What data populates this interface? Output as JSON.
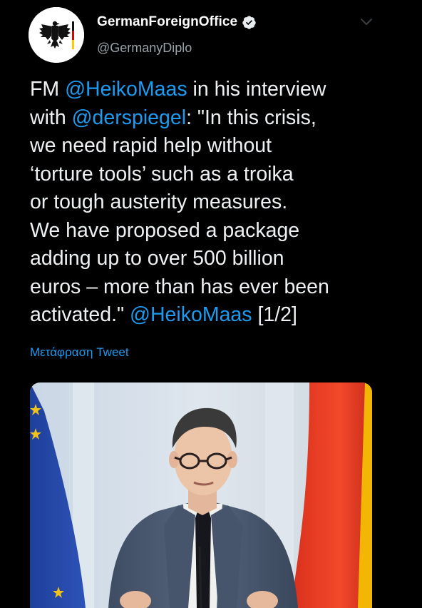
{
  "account": {
    "display_name": "GermanForeignOffice",
    "handle": "@GermanyDiplo",
    "verified": true
  },
  "tweet": {
    "lines": [
      [
        {
          "t": "FM ",
          "m": false
        },
        {
          "t": "@HeikoMaas",
          "m": true
        },
        {
          "t": " in his interview",
          "m": false
        }
      ],
      [
        {
          "t": "with ",
          "m": false
        },
        {
          "t": "@derspiegel",
          "m": true
        },
        {
          "t": ": \"In this crisis,",
          "m": false
        }
      ],
      [
        {
          "t": "we need rapid help without",
          "m": false
        }
      ],
      [
        {
          "t": "‘torture tools’ such as a troika",
          "m": false
        }
      ],
      [
        {
          "t": "or tough austerity measures.",
          "m": false
        }
      ],
      [
        {
          "t": "We have proposed a package",
          "m": false
        }
      ],
      [
        {
          "t": "adding up to over 500 billion",
          "m": false
        }
      ],
      [
        {
          "t": "euros – more than has ever been",
          "m": false
        }
      ],
      [
        {
          "t": "activated.\" ",
          "m": false
        },
        {
          "t": "@HeikoMaas",
          "m": true
        },
        {
          "t": " [1/2]",
          "m": false
        }
      ]
    ],
    "translate_label": "Μετάφραση Tweet"
  },
  "icons": {
    "avatar": "federal-eagle-icon",
    "verified": "verified-badge-icon",
    "menu": "chevron-down-icon"
  },
  "colors": {
    "background": "#000000",
    "text": "#eef1f3",
    "secondary_text": "#9aa2a9",
    "link": "#1d9bf0"
  }
}
